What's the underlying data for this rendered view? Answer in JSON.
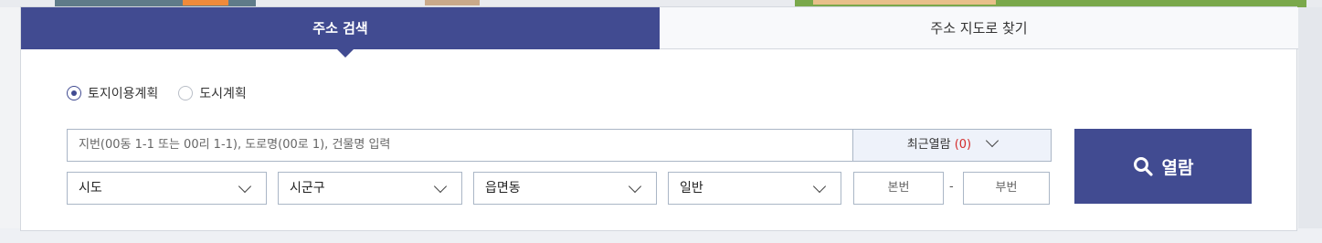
{
  "tabs": {
    "address_search": "주소 검색",
    "map_search": "주소 지도로 찾기"
  },
  "radios": [
    {
      "label": "토지이용계획",
      "checked": true
    },
    {
      "label": "도시계획",
      "checked": false
    }
  ],
  "search": {
    "placeholder": "지번(00동 1-1 또는 00리 1-1), 도로명(00로 1), 건물명 입력"
  },
  "recent": {
    "label": "최근열람",
    "count": "(0)"
  },
  "selects": {
    "sido": "시도",
    "sigungu": "시군구",
    "eupmyeondong": "읍면동",
    "type": "일반"
  },
  "lot": {
    "main": "본번",
    "sep": "-",
    "sub": "부번"
  },
  "view_button": {
    "label": "열람"
  },
  "colors": {
    "primary": "#414b91",
    "count_red": "#d42b2b"
  }
}
